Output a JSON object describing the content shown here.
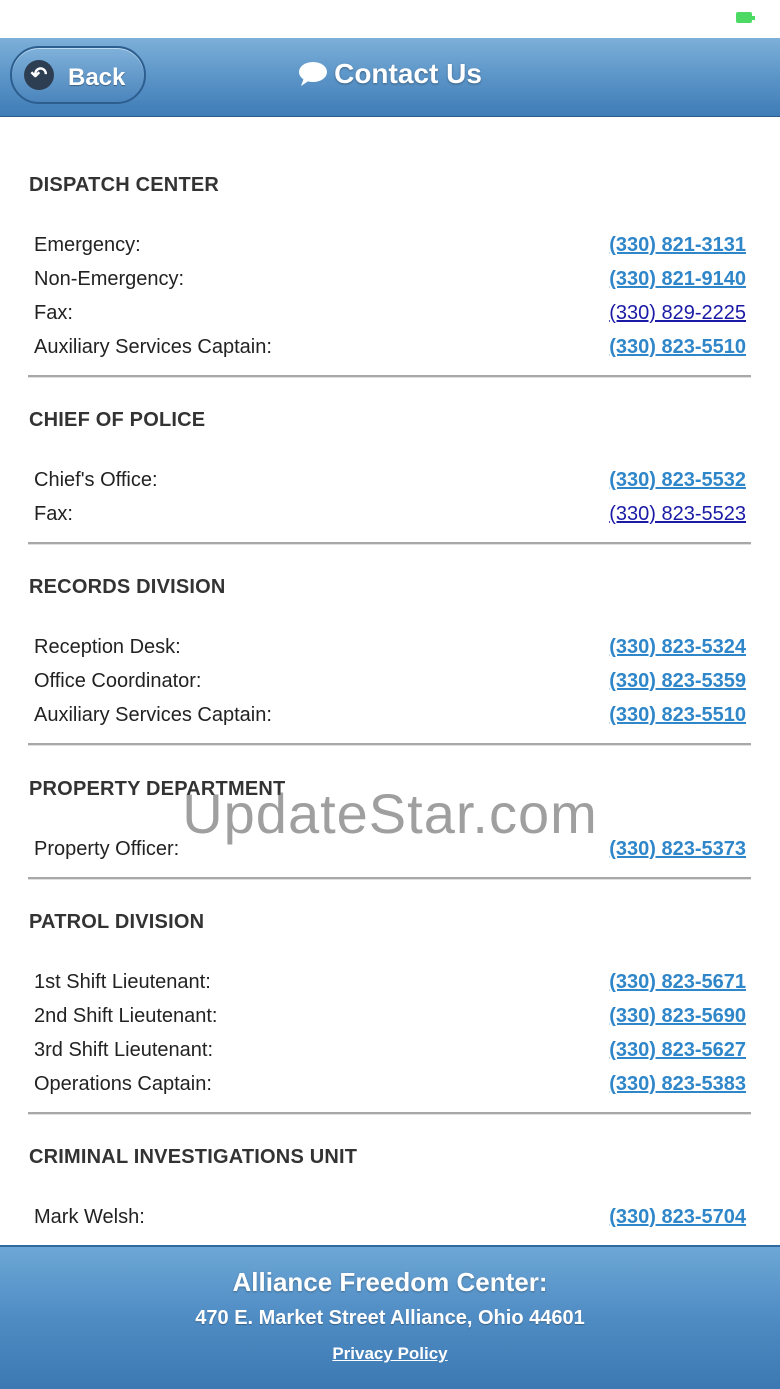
{
  "header": {
    "back_label": "Back",
    "title": "Contact Us"
  },
  "sections": [
    {
      "title": "DISPATCH CENTER",
      "rows": [
        {
          "label": "Emergency:",
          "phone": "(330) 821-3131"
        },
        {
          "label": "Non-Emergency:",
          "phone": "(330) 821-9140"
        },
        {
          "label": "Fax:",
          "phone": "(330) 829-2225"
        },
        {
          "label": "Auxiliary Services Captain:",
          "phone": "(330) 823-5510"
        }
      ]
    },
    {
      "title": "CHIEF OF POLICE",
      "rows": [
        {
          "label": "Chief's Office:",
          "phone": "(330) 823-5532"
        },
        {
          "label": "Fax:",
          "phone": "(330) 823-5523"
        }
      ]
    },
    {
      "title": "RECORDS DIVISION",
      "rows": [
        {
          "label": "Reception Desk:",
          "phone": "(330) 823-5324"
        },
        {
          "label": "Office Coordinator:",
          "phone": "(330) 823-5359"
        },
        {
          "label": "Auxiliary Services Captain:",
          "phone": "(330) 823-5510"
        }
      ]
    },
    {
      "title": "PROPERTY DEPARTMENT",
      "rows": [
        {
          "label": "Property Officer:",
          "phone": "(330) 823-5373"
        }
      ]
    },
    {
      "title": "PATROL DIVISION",
      "rows": [
        {
          "label": "1st Shift Lieutenant:",
          "phone": "(330) 823-5671"
        },
        {
          "label": "2nd Shift Lieutenant:",
          "phone": "(330) 823-5690"
        },
        {
          "label": "3rd Shift Lieutenant:",
          "phone": "(330) 823-5627"
        },
        {
          "label": "Operations Captain:",
          "phone": "(330) 823-5383"
        }
      ]
    },
    {
      "title": "CRIMINAL INVESTIGATIONS UNIT",
      "rows": [
        {
          "label": "Mark Welsh:",
          "phone": "(330) 823-5704"
        }
      ]
    }
  ],
  "watermark": "UpdateStar.com",
  "footer": {
    "title": "Alliance Freedom Center:",
    "address": "470 E. Market Street Alliance, Ohio 44601",
    "privacy_label": "Privacy Policy"
  },
  "colors": {
    "header_blue": "#5e97c9",
    "link_blue": "#2f86c9",
    "battery_green": "#4cd964"
  }
}
